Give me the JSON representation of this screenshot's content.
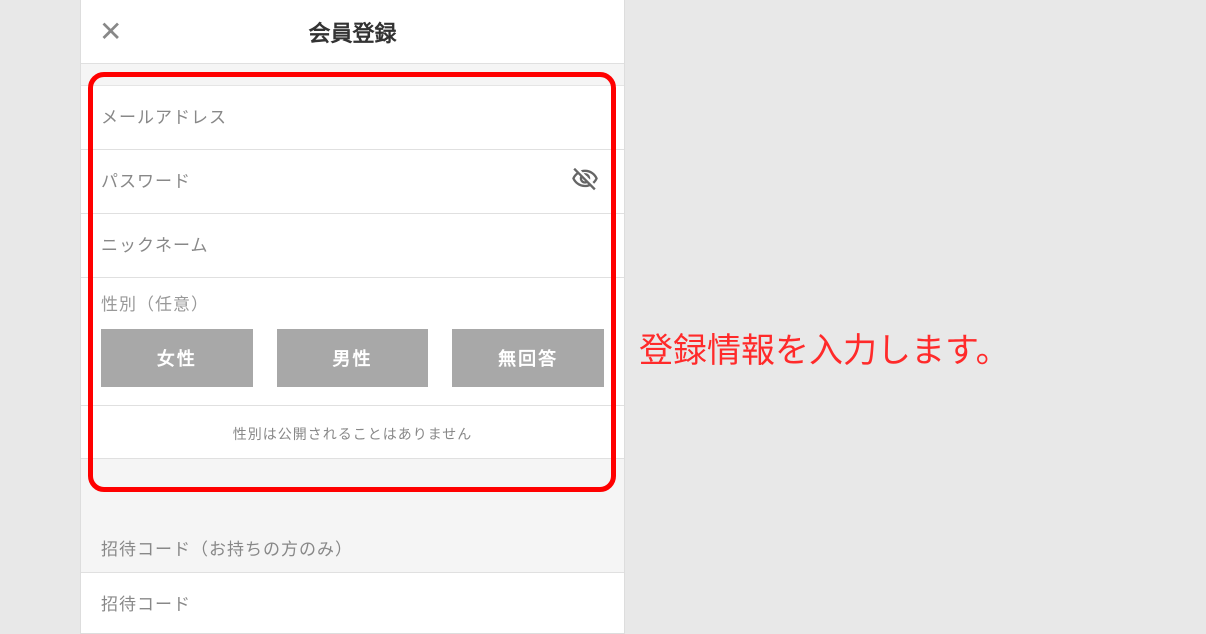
{
  "header": {
    "title": "会員登録"
  },
  "form": {
    "email_placeholder": "メールアドレス",
    "password_placeholder": "パスワード",
    "nickname_placeholder": "ニックネーム",
    "gender_label": "性別（任意）",
    "gender_female": "女性",
    "gender_male": "男性",
    "gender_noanswer": "無回答",
    "gender_note": "性別は公開されることはありません",
    "invite_header": "招待コード（お持ちの方のみ）",
    "invite_placeholder": "招待コード"
  },
  "instruction": "登録情報を入力します。"
}
